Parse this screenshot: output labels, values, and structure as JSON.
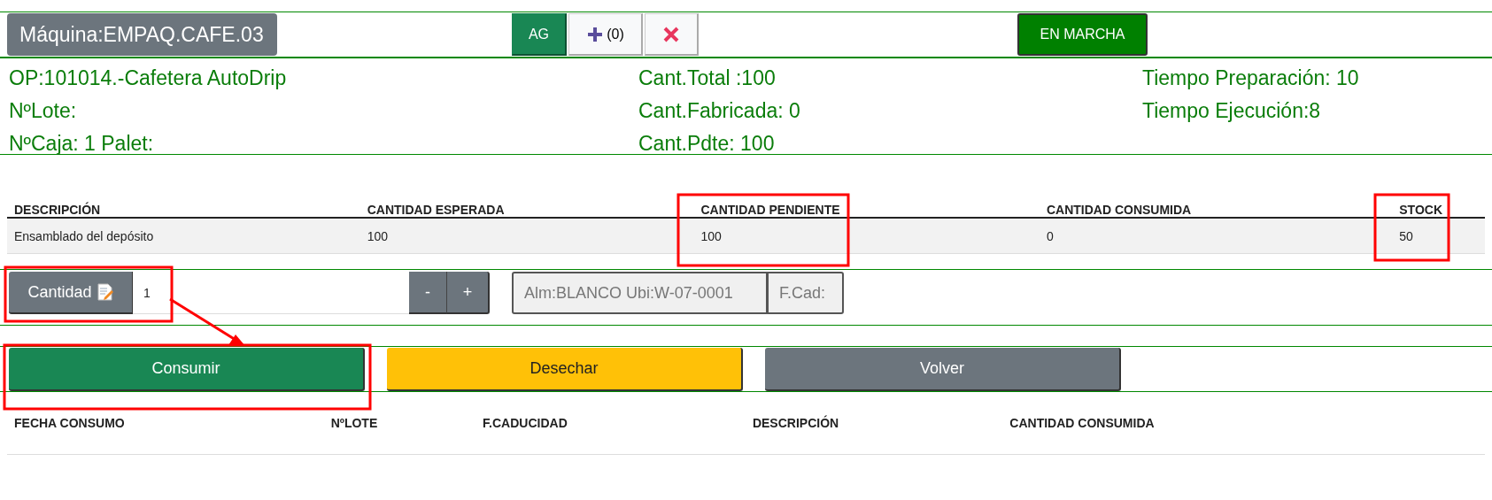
{
  "header": {
    "machine": "Máquina:EMPAQ.CAFE.03",
    "buttons": [
      {
        "kind": "text",
        "label": "AG"
      },
      {
        "kind": "add",
        "label": "(0)"
      },
      {
        "kind": "delete"
      }
    ],
    "status": "EN MARCHA"
  },
  "info": {
    "columns": [
      [
        "OP:101014.-Cafetera AutoDrip",
        "NºLote:",
        "NºCaja: 1 Palet:"
      ],
      [
        "Cant.Total :100",
        "Cant.Fabricada: 0",
        "Cant.Pdte: 100"
      ],
      [
        "Tiempo Preparación: 10",
        "Tiempo Ejecución:8"
      ]
    ]
  },
  "components_table": {
    "columns": [
      "DESCRIPCIÓN",
      "CANTIDAD ESPERADA",
      "CANTIDAD PENDIENTE",
      "CANTIDAD CONSUMIDA",
      "STOCK"
    ],
    "rows": [
      [
        "Ensamblado del depósito",
        "100",
        "100",
        "0",
        "50"
      ]
    ]
  },
  "quantity": {
    "label": "Cantidad",
    "value": "1",
    "decrement": "-",
    "increment": "+",
    "location": "Alm:BLANCO Ubi:W-07-0001",
    "expiry": "F.Cad:"
  },
  "actions": [
    {
      "kind": "primary",
      "label": "Consumir"
    },
    {
      "kind": "warning",
      "label": "Desechar"
    },
    {
      "kind": "secondary",
      "label": "Volver"
    }
  ],
  "consumption_table": {
    "columns": [
      "FECHA CONSUMO",
      "NºLOTE",
      "F.CADUCIDAD",
      "DESCRIPCIÓN",
      "CANTIDAD CONSUMIDA"
    ]
  }
}
